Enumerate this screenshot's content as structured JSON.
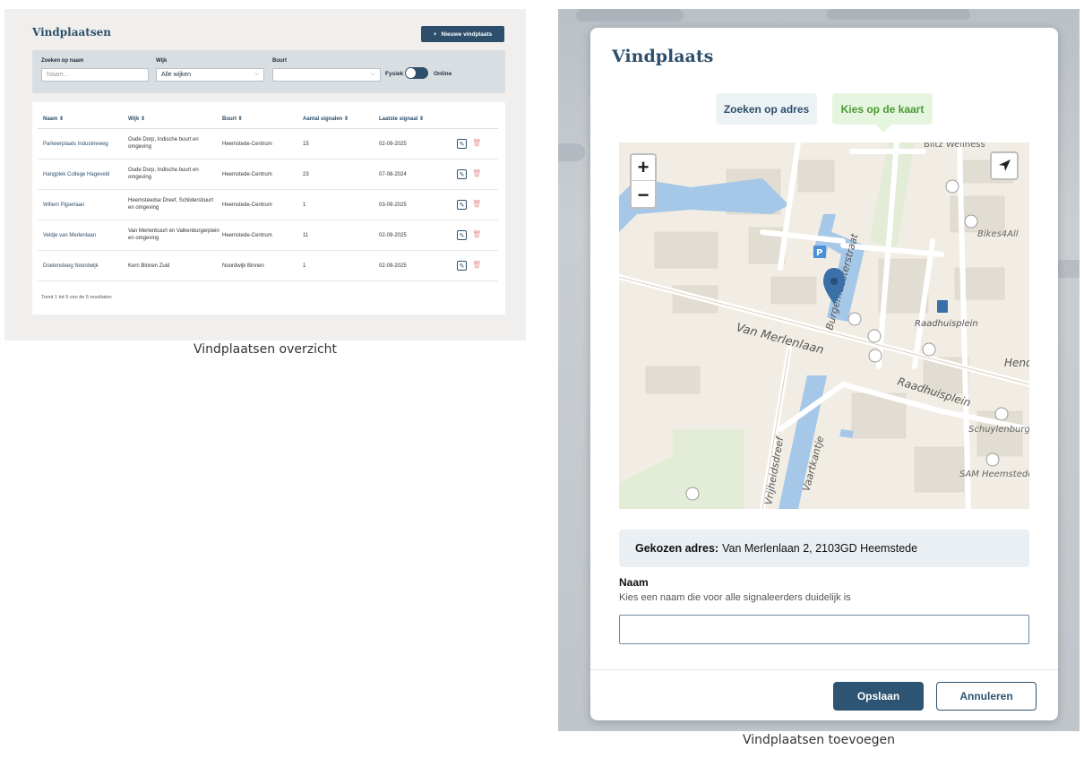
{
  "overview": {
    "title": "Vindplaatsen",
    "new_button": "Nieuwe vindplaats",
    "new_button_icon": "+",
    "filters": {
      "search_label": "Zoeken op naam",
      "search_placeholder": "Naam...",
      "wijk_label": "Wijk",
      "wijk_value": "Alle wijken",
      "buurt_label": "Buurt",
      "buurt_value": "",
      "toggle_left": "Fysiek",
      "toggle_right": "Online"
    },
    "table": {
      "headers": [
        "Naam ⇕",
        "Wijk ⇕",
        "Buurt ⇕",
        "Aantal signalen ⇕",
        "Laatste signaal ⇕"
      ],
      "rows": [
        {
          "naam": "Parkeerplaats Industrieweg",
          "wijk": "Oude Dorp, Indische buurt en omgeving",
          "buurt": "Heemstede-Centrum",
          "aantal": "15",
          "laatste": "02-09-2025"
        },
        {
          "naam": "Hangplek College Hageveld",
          "wijk": "Oude Dorp, Indische buurt en omgeving",
          "buurt": "Heemstede-Centrum",
          "aantal": "23",
          "laatste": "07-08-2024"
        },
        {
          "naam": "Willem Pijperlaan",
          "wijk": "Heemsteedse Dreef, Schildersbuurt en omgeving",
          "buurt": "Heemstede-Centrum",
          "aantal": "1",
          "laatste": "03-09-2025"
        },
        {
          "naam": "Veldje van Merlenlaan",
          "wijk": "Van Merlenbuurt en Valkenburgerplein en omgeving",
          "buurt": "Heemstede-Centrum",
          "aantal": "11",
          "laatste": "02-09-2025"
        },
        {
          "naam": "Doelensteeg Noordwijk",
          "wijk": "Kern Binnen Zuid",
          "buurt": "Noordwijk Binnen",
          "aantal": "1",
          "laatste": "02-09-2025"
        }
      ],
      "footer": "Toont 1 tot 5 van de 5 resultaten"
    },
    "caption": "Vindplaatsen overzicht"
  },
  "add": {
    "title": "Vindplaats",
    "tab_address": "Zoeken op adres",
    "tab_map": "Kies op de kaart",
    "zoom_in": "+",
    "zoom_out": "−",
    "map_labels": {
      "street1": "Van Merlenlaan",
      "street2": "Raadhuisplein",
      "street3": "Raadhuisplein",
      "street4": "Burgemeesterstraat",
      "street5": "Vrijheidsdreef",
      "street6": "Vaartkantje",
      "poi1": "Bikes4All",
      "poi2": "Schuylenburgh",
      "poi3": "SAM Heemstede",
      "poi4": "Blitz Wellness",
      "poi5": "Hend",
      "parking": "P"
    },
    "address_label": "Gekozen adres:",
    "address_value": "Van Merlenlaan 2, 2103GD Heemstede",
    "naam_label": "Naam",
    "naam_help": "Kies een naam die voor alle signaleerders duidelijk is",
    "save": "Opslaan",
    "cancel": "Annuleren",
    "caption": "Vindplaatsen toevoegen"
  },
  "colors": {
    "primary": "#2d4f6b",
    "map_tab_green": "#4b9a35",
    "water": "#a6c8e8",
    "marker": "#3a6fa8"
  }
}
